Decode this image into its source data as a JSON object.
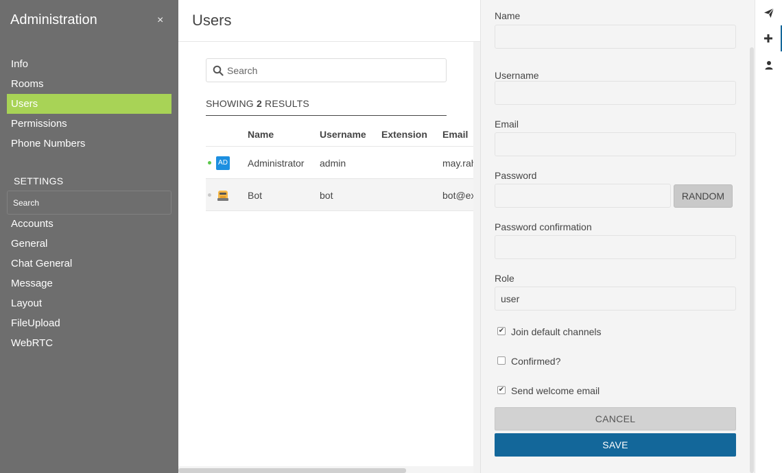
{
  "sidebar": {
    "title": "Administration",
    "close_symbol": "×",
    "items": [
      {
        "label": "Info",
        "active": false
      },
      {
        "label": "Rooms",
        "active": false
      },
      {
        "label": "Users",
        "active": true
      },
      {
        "label": "Permissions",
        "active": false
      },
      {
        "label": "Phone Numbers",
        "active": false
      }
    ],
    "settings_title": "SETTINGS",
    "settings_search_placeholder": "Search",
    "settings_items": [
      "Accounts",
      "General",
      "Chat General",
      "Message",
      "Layout",
      "FileUpload",
      "WebRTC"
    ]
  },
  "main": {
    "title": "Users",
    "search_placeholder": "Search",
    "results_prefix": "SHOWING",
    "results_count": "2",
    "results_suffix": "RESULTS",
    "columns": [
      "Name",
      "Username",
      "Extension",
      "Email"
    ],
    "rows": [
      {
        "avatar_text": "AD",
        "avatar_color": "#1d8fe0",
        "status_color": "#5cc74a",
        "name": "Administrator",
        "username": "admin",
        "extension": "",
        "email": "may.rahman@example.com"
      },
      {
        "avatar_text": "",
        "avatar_color": "#f5b84a",
        "status_color": "#c8c8c8",
        "name": "Bot",
        "username": "bot",
        "extension": "",
        "email": "bot@example.com"
      }
    ]
  },
  "form": {
    "name_label": "Name",
    "name_value": "",
    "username_label": "Username",
    "username_value": "",
    "email_label": "Email",
    "email_value": "",
    "password_label": "Password",
    "password_value": "",
    "random_label": "RANDOM",
    "password_confirm_label": "Password confirmation",
    "password_confirm_value": "",
    "role_label": "Role",
    "role_value": "user",
    "join_channels_label": "Join default channels",
    "join_channels_checked": true,
    "confirmed_label": "Confirmed?",
    "confirmed_checked": false,
    "welcome_email_label": "Send welcome email",
    "welcome_email_checked": true,
    "cancel_label": "CANCEL",
    "save_label": "SAVE"
  },
  "toolbar": {
    "icons": [
      "paper-plane-icon",
      "plus-icon",
      "user-icon"
    ],
    "active_index": 1
  },
  "colors": {
    "sidebar_bg": "#6e6e6e",
    "active_item": "#a8d356",
    "save_button": "#13679a"
  }
}
